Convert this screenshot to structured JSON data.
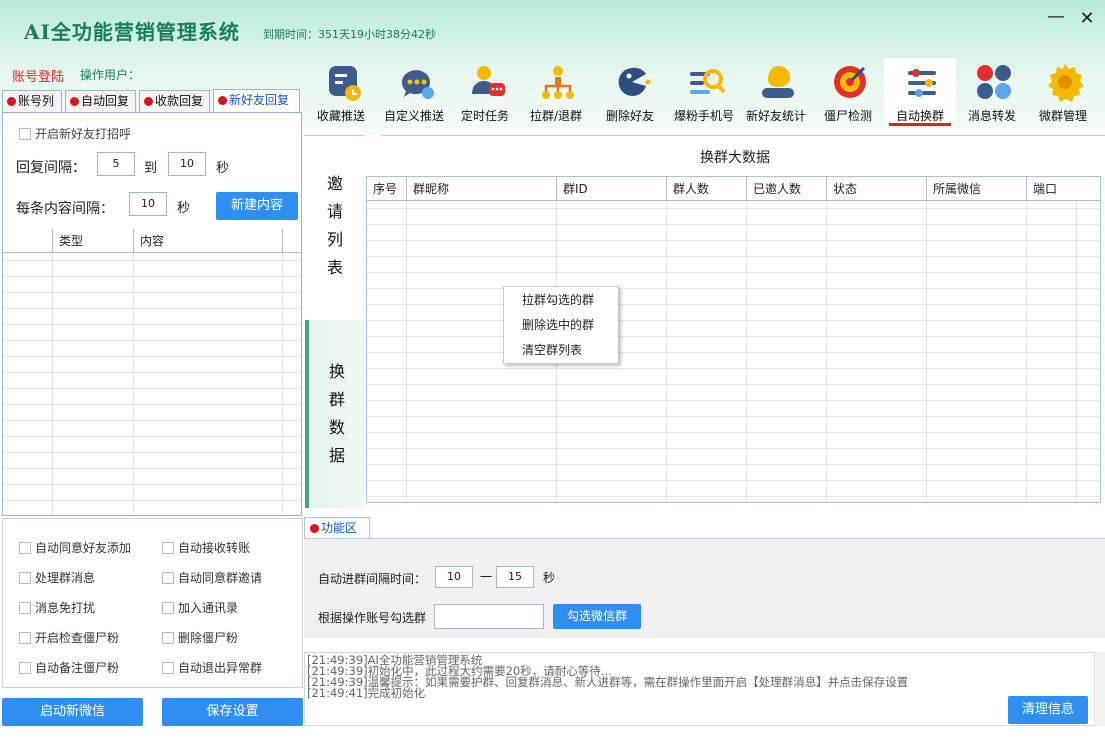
{
  "app": {
    "title": "AI全功能营销管理系统",
    "expire": "到期时间：351天19小时38分42秒"
  },
  "account": {
    "login": "账号登陆",
    "operator": "操作用户："
  },
  "left_tabs": [
    "账号列",
    "自动回复",
    "收款回复",
    "新好友回复"
  ],
  "toolbar": [
    {
      "label": "收藏推送",
      "icon": "favorites-push-icon"
    },
    {
      "label": "自定义推送",
      "icon": "custom-push-icon"
    },
    {
      "label": "定时任务",
      "icon": "scheduled-task-icon"
    },
    {
      "label": "拉群/退群",
      "icon": "group-join-icon"
    },
    {
      "label": "删除好友",
      "icon": "delete-friend-icon"
    },
    {
      "label": "爆粉手机号",
      "icon": "phone-search-icon"
    },
    {
      "label": "新好友统计",
      "icon": "new-friend-stats-icon"
    },
    {
      "label": "僵尸检测",
      "icon": "zombie-detect-icon"
    },
    {
      "label": "自动换群",
      "icon": "auto-switch-group-icon"
    },
    {
      "label": "消息转发",
      "icon": "message-forward-icon"
    },
    {
      "label": "微群管理",
      "icon": "group-manage-icon"
    }
  ],
  "greet": {
    "enable_label": "开启新好友打招呼",
    "interval_label": "回复间隔：",
    "interval_min": "5",
    "to": "到",
    "interval_max": "10",
    "unit": "秒",
    "content_interval_label": "每条内容间隔：",
    "content_interval": "10",
    "new_button": "新建内容",
    "table_headers": [
      "类型",
      "内容"
    ]
  },
  "options": [
    "自动同意好友添加",
    "自动接收转账",
    "处理群消息",
    "自动同意群邀请",
    "消息免打扰",
    "加入通讯录",
    "开启检查僵尸粉",
    "删除僵尸粉",
    "自动备注僵尸粉",
    "自动退出异常群"
  ],
  "bottom_buttons": {
    "start": "启动新微信",
    "save": "保存设置"
  },
  "switch": {
    "title": "换群大数据",
    "vtab_invite": [
      "邀",
      "请",
      "列",
      "表"
    ],
    "vtab_switch": [
      "换",
      "群",
      "数",
      "据"
    ],
    "headers": [
      "序号",
      "群昵称",
      "群ID",
      "群人数",
      "已邀人数",
      "状态",
      "所属微信",
      "端口"
    ]
  },
  "context_menu": [
    "拉群勾选的群",
    "删除选中的群",
    "清空群列表"
  ],
  "func": {
    "tab": "功能区",
    "interval_label": "自动进群间隔时间：",
    "interval_min": "10",
    "dash": "一",
    "interval_max": "15",
    "unit": "秒",
    "select_label": "根据操作账号勾选群",
    "select_value": "",
    "select_button": "勾选微信群"
  },
  "log": [
    "[21:49:39]AI全功能营销管理系统",
    "[21:49:39]初始化中，此过程大约需要20秒，请耐心等待...",
    "[21:49:39]温馨提示：如果需要护群、回复群消息、新人进群等，需在群操作里面开启【处理群消息】并点击保存设置",
    "[21:49:41]完成初始化"
  ],
  "clear_button": "清理信息",
  "colors": {
    "accent": "#2f8ff0",
    "brand": "#1a7d5c",
    "danger": "#e01e26"
  }
}
